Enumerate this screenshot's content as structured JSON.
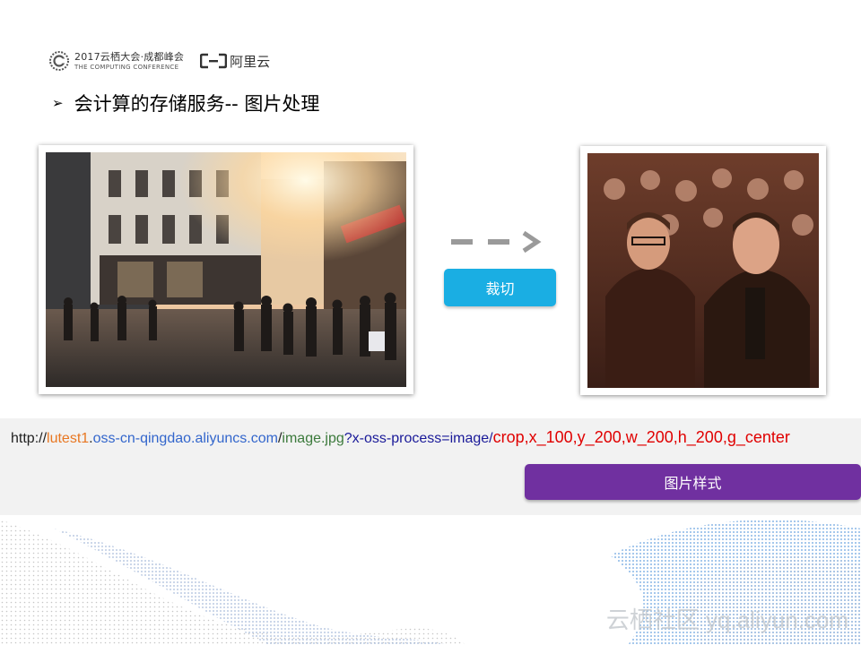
{
  "header": {
    "conference_line1": "2017云栖大会·成都峰会",
    "conference_line2": "THE COMPUTING CONFERENCE",
    "brand_name": "阿里云"
  },
  "slide": {
    "bullet": "➢",
    "title": "会计算的存储服务--  图片处理"
  },
  "buttons": {
    "crop_label": "裁切",
    "style_label": "图片样式"
  },
  "url": {
    "protocol": "http://",
    "bucket": "lutest1",
    "dot": ".",
    "endpoint": "oss-cn-qingdao.aliyuncs.com",
    "slash": "/",
    "object": "image.jpg",
    "query": "?x-oss-process=image/",
    "params": "crop,x_100,y_200,w_200,h_200,g_center"
  },
  "watermark": "云栖社区 yq.aliyun.com",
  "colors": {
    "crop_button": "#1aaee3",
    "style_button": "#7030a0",
    "url_bucket": "#e87722",
    "url_endpoint": "#3366cc",
    "url_object": "#3c7a3c",
    "url_query": "#1a1a99",
    "url_params": "#e00000"
  },
  "icons": {
    "arrow": "dashed-right-arrow-icon",
    "conference": "computing-conference-logo",
    "brand": "aliyun-logo"
  }
}
